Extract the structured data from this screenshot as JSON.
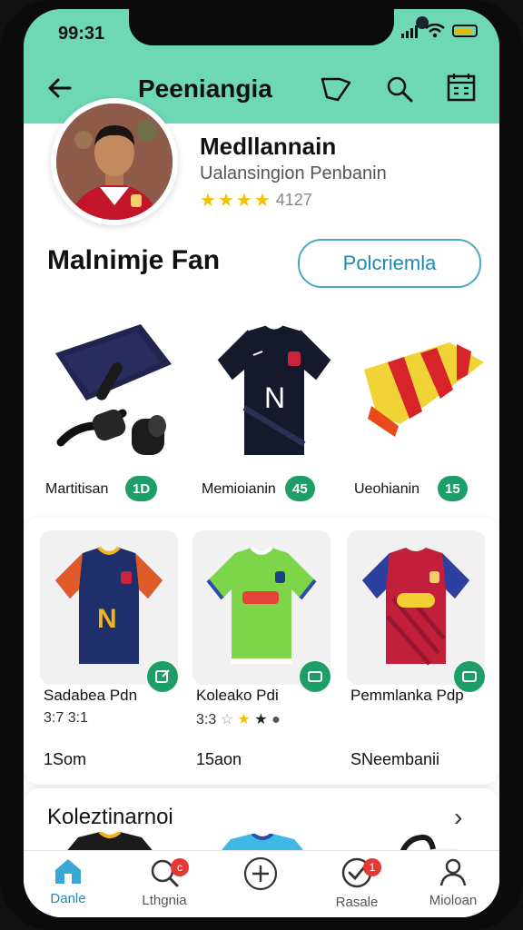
{
  "status_bar": {
    "time": "99:31"
  },
  "header": {
    "title": "Peeniangia"
  },
  "profile": {
    "name": "Medllannain",
    "subtitle": "Ualansingion Penbanin",
    "rating_value": 3.5,
    "rating_count": "4127"
  },
  "section": {
    "title": "Malnimje Fan",
    "action_label": "Polcriemla"
  },
  "featured": [
    {
      "label": "Martitisan",
      "price": "1D",
      "icon": "scarf-and-accessories"
    },
    {
      "label": "Memioianin",
      "price": "45",
      "icon": "black-jersey"
    },
    {
      "label": "Ueohianin",
      "price": "15",
      "icon": "red-yellow-scarf"
    }
  ],
  "cards": [
    {
      "name": "Sadabea Pdn",
      "meta": "3:7 3:1",
      "price": "1Som",
      "jersey_colors": {
        "body": "#1f2f6b",
        "accent": "#e05b28"
      }
    },
    {
      "name": "Koleako Pdi",
      "meta": "3:3",
      "price": "15aon",
      "jersey_colors": {
        "body": "#7dd64a",
        "accent": "#2b4fa8"
      }
    },
    {
      "name": "Pemmlanka Pdp",
      "meta": "",
      "price": "SNeembanii",
      "jersey_colors": {
        "body": "#c2203a",
        "accent": "#2a3f9e"
      }
    }
  ],
  "collection": {
    "title": "Koleztinarnoi"
  },
  "navbar": [
    {
      "label": "Danle",
      "icon": "home-icon",
      "active": true
    },
    {
      "label": "Lthgnia",
      "icon": "search-icon",
      "badge": "c"
    },
    {
      "label": "",
      "icon": "add-icon"
    },
    {
      "label": "Rasale",
      "icon": "check-icon",
      "badge": "1"
    },
    {
      "label": "Mioloan",
      "icon": "profile-icon"
    }
  ],
  "colors": {
    "header_bg": "#6ed8b4",
    "accent_green": "#1e9e67",
    "accent_blue": "#1f88b6",
    "star": "#f2c200"
  }
}
